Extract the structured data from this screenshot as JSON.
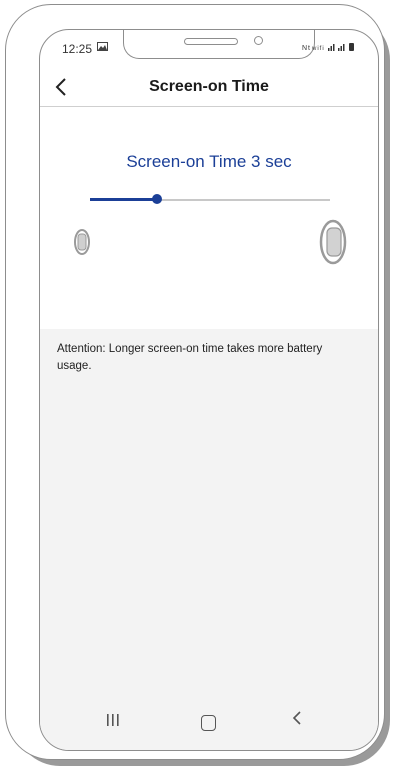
{
  "status_bar": {
    "time": "12:25",
    "left_icons": "gallery-icon",
    "right_icons": "signal-wifi-battery-icons"
  },
  "header": {
    "back_icon": "chevron-left-icon",
    "title": "Screen-on Time"
  },
  "screen_on_setting": {
    "label": "Screen-on Time 3 sec",
    "slider_value_fraction": 0.28
  },
  "attention": {
    "text": "Attention: Longer screen-on time takes more battery usage."
  },
  "nav_bar": {
    "recents_icon": "recents-icon",
    "home_icon": "home-icon",
    "back_icon": "back-icon"
  },
  "colors": {
    "accent": "#1b3f97",
    "background_gray": "#f3f3f3"
  }
}
